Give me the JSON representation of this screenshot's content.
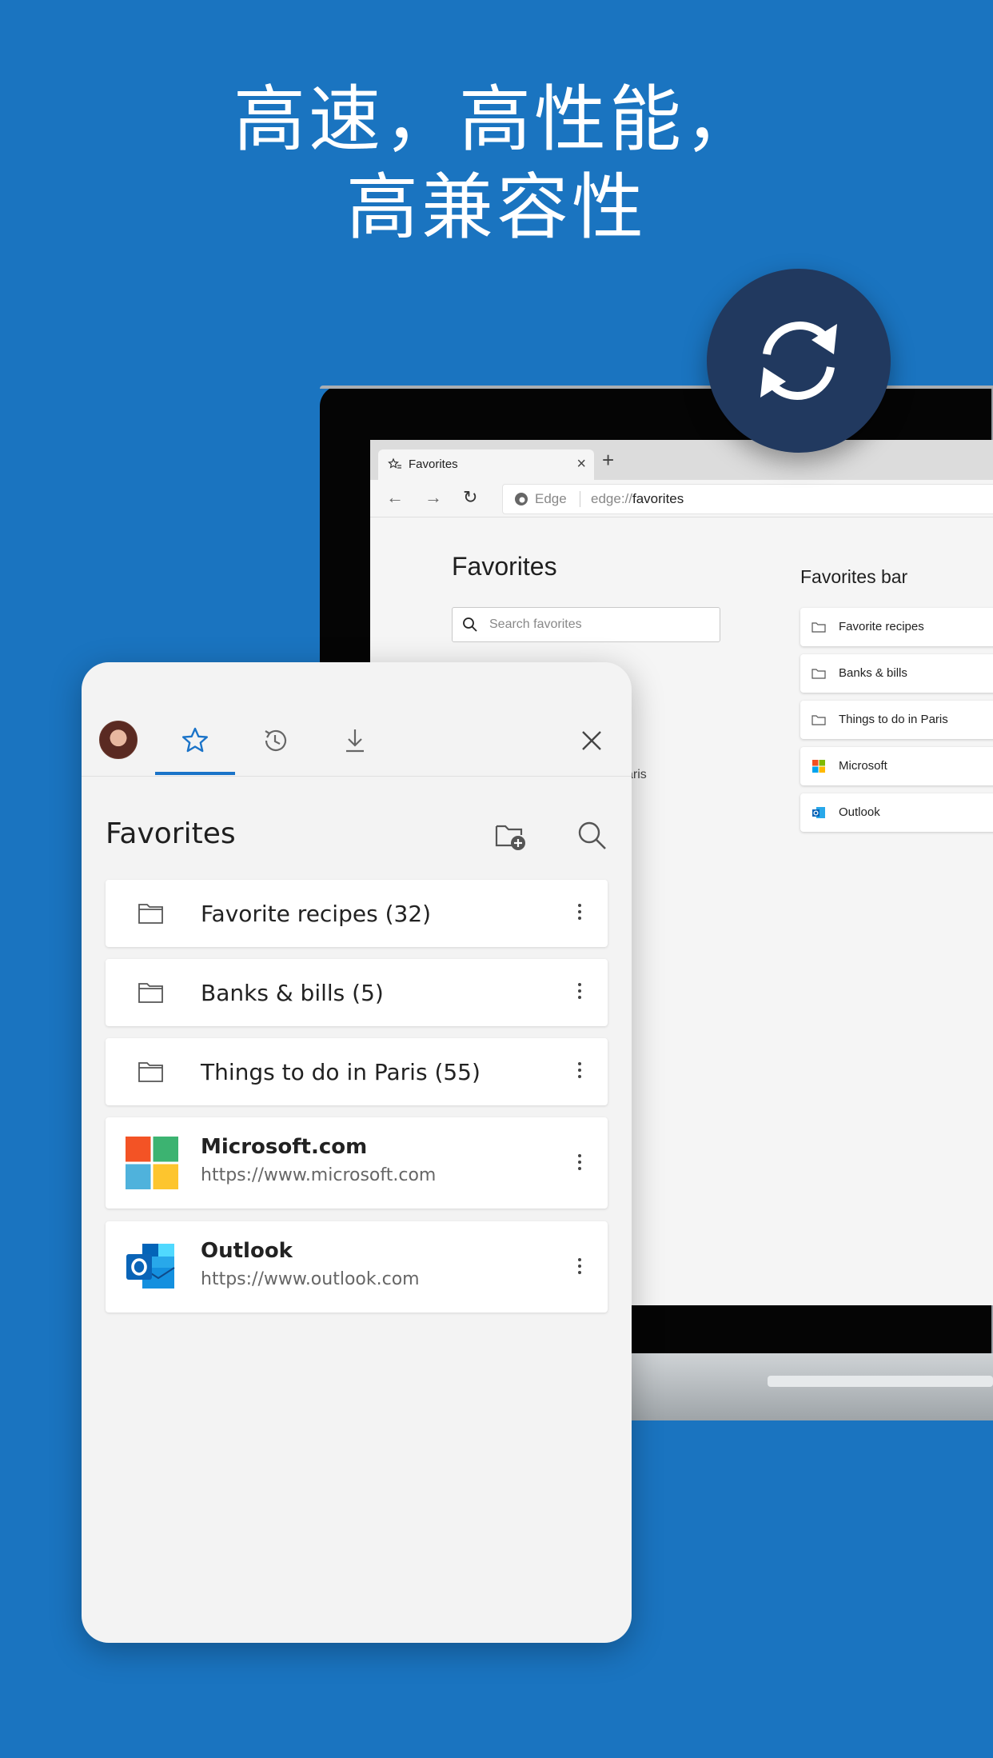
{
  "headline": {
    "line1": "高速，高性能，",
    "line2": "高兼容性"
  },
  "browser": {
    "tab_title": "Favorites",
    "tab_close": "×",
    "new_tab": "+",
    "address_label": "Edge",
    "url_scheme": "edge://",
    "url_path": "favorites",
    "page_title": "Favorites",
    "search_placeholder": "Search favorites",
    "ghost_text": "aris",
    "favorites_bar": {
      "title": "Favorites bar",
      "items": [
        {
          "label": "Favorite recipes",
          "icon": "folder-icon"
        },
        {
          "label": "Banks & bills",
          "icon": "folder-icon"
        },
        {
          "label": "Things to do in Paris",
          "icon": "folder-icon"
        },
        {
          "label": "Microsoft",
          "icon": "microsoft-logo-icon"
        },
        {
          "label": "Outlook",
          "icon": "outlook-logo-icon"
        }
      ]
    }
  },
  "panel": {
    "tabs": [
      {
        "name": "favorites",
        "icon": "star-icon",
        "active": true
      },
      {
        "name": "history",
        "icon": "history-icon",
        "active": false
      },
      {
        "name": "downloads",
        "icon": "download-icon",
        "active": false
      }
    ],
    "heading": "Favorites",
    "folders": [
      {
        "label": "Favorite recipes (32)"
      },
      {
        "label": "Banks & bills (5)"
      },
      {
        "label": "Things to do in Paris (55)"
      }
    ],
    "sites": [
      {
        "title": "Microsoft.com",
        "url": "https://www.microsoft.com"
      },
      {
        "title": "Outlook",
        "url": "https://www.outlook.com"
      }
    ]
  },
  "colors": {
    "background": "#1a74c0",
    "sync_badge": "#21395f",
    "accent": "#1a73c8"
  }
}
